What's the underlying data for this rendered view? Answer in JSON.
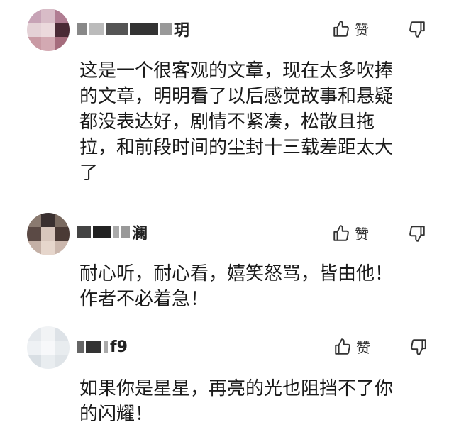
{
  "comments": [
    {
      "username_visible": "玥",
      "like_label": "赞",
      "text": "这是一个很客观的文章，现在太多吹捧\n的文章，明明看了以后感觉故事和悬疑\n都没表达好，剧情不紧凑，松散且拖\n拉，和前段时间的尘封十三载差距太大\n了"
    },
    {
      "username_visible": "澜",
      "like_label": "赞",
      "text": "耐心听，耐心看，嬉笑怒骂，皆由他！\n作者不必着急！"
    },
    {
      "username_visible": "f9",
      "like_label": "赞",
      "text": "如果你是星星，再亮的光也阻挡不了你\n的闪耀！"
    }
  ],
  "icons": {
    "like": "thumbs-up-icon",
    "dislike": "thumbs-down-icon"
  }
}
